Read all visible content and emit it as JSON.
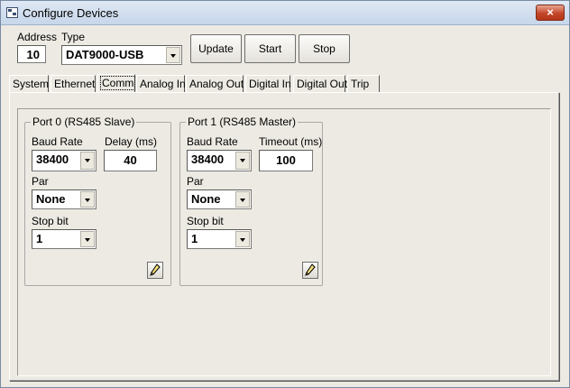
{
  "window": {
    "title": "Configure Devices",
    "close_glyph": "×"
  },
  "header": {
    "address_label": "Address",
    "address_value": "10",
    "type_label": "Type",
    "type_value": "DAT9000-USB",
    "buttons": [
      "Update",
      "Start",
      "Stop"
    ]
  },
  "tabs": [
    {
      "label": "System",
      "active": false
    },
    {
      "label": "Ethernet",
      "active": false
    },
    {
      "label": "Comm",
      "active": true
    },
    {
      "label": "Analog In",
      "active": false
    },
    {
      "label": "Analog Out",
      "active": false
    },
    {
      "label": "Digital In",
      "active": false
    },
    {
      "label": "Digital Out",
      "active": false
    },
    {
      "label": "Trip",
      "active": false
    }
  ],
  "ports": [
    {
      "title": "Port 0 (RS485 Slave)",
      "baud_label": "Baud Rate",
      "baud_value": "38400",
      "second_label": "Delay (ms)",
      "second_value": "40",
      "par_label": "Par",
      "par_value": "None",
      "stop_label": "Stop bit",
      "stop_value": "1",
      "edit_icon": "pencil-icon"
    },
    {
      "title": "Port 1 (RS485 Master)",
      "baud_label": "Baud Rate",
      "baud_value": "38400",
      "second_label": "Timeout (ms)",
      "second_value": "100",
      "par_label": "Par",
      "par_value": "None",
      "stop_label": "Stop bit",
      "stop_value": "1",
      "edit_icon": "pencil-icon"
    }
  ],
  "colors": {
    "window_bg": "#eceae2",
    "titlebar": "#c7d6ea",
    "close": "#c4462a"
  }
}
